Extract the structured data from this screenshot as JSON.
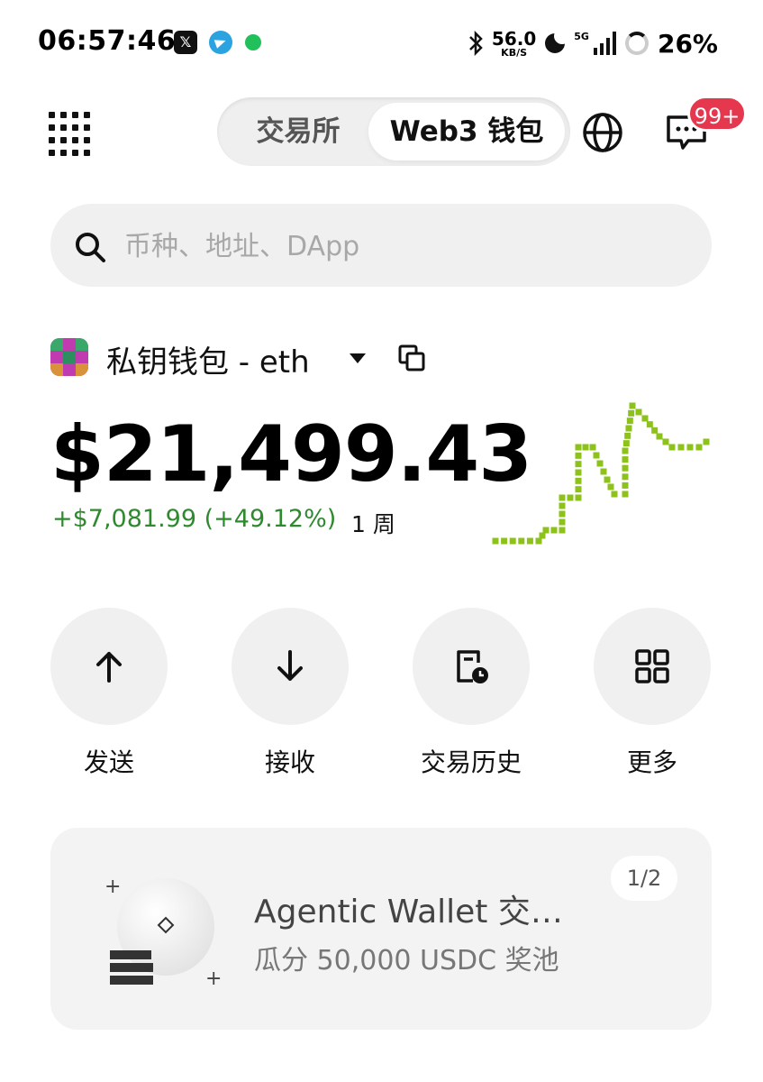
{
  "status_bar": {
    "time": "06:57:46",
    "apps": [
      "x-icon",
      "telegram-icon",
      "message-icon"
    ],
    "net_speed_value": "56.0",
    "net_speed_unit": "KB/S",
    "network_type": "5G",
    "battery": "26%"
  },
  "header": {
    "tabs": [
      {
        "label": "交易所",
        "active": false
      },
      {
        "label": "Web3 钱包",
        "active": true
      }
    ],
    "notification_badge": "99+"
  },
  "search": {
    "placeholder": "币种、地址、DApp"
  },
  "wallet": {
    "name": "私钥钱包 - eth",
    "balance": "$21,499.43",
    "change": "+$7,081.99 (+49.12%)",
    "period": "1 周",
    "positive_color": "#2f8a2f",
    "sparkline_color": "#8cc21a"
  },
  "actions": [
    {
      "label": "发送",
      "icon": "arrow-up-icon"
    },
    {
      "label": "接收",
      "icon": "arrow-down-icon"
    },
    {
      "label": "交易历史",
      "icon": "history-icon"
    },
    {
      "label": "更多",
      "icon": "grid-icon"
    }
  ],
  "promo": {
    "title": "Agentic Wallet 交…",
    "subtitle": "瓜分 50,000 USDC 奖池",
    "pager": "1/2"
  }
}
